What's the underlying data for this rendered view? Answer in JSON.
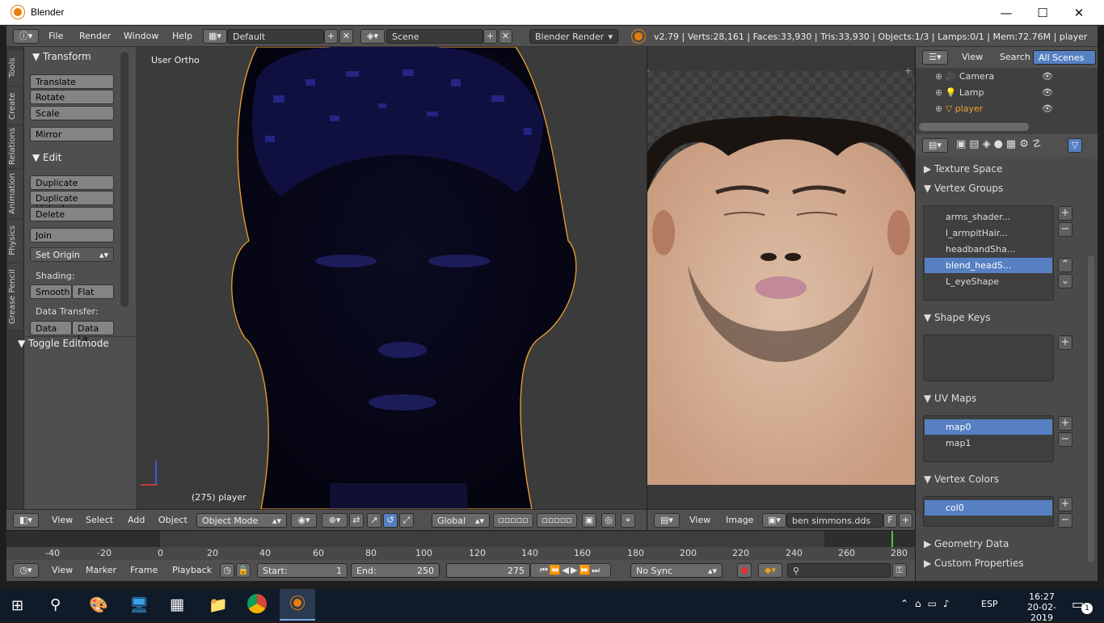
{
  "window": {
    "app_title": "Blender",
    "minimize": "—",
    "maximize": "☐",
    "close": "✕"
  },
  "infobar": {
    "menus": [
      "File",
      "Render",
      "Window",
      "Help"
    ],
    "screen_layout": "Default",
    "scene": "Scene",
    "render_engine": "Blender Render",
    "stats": "v2.79 | Verts:28,161 | Faces:33,930 | Tris:33,930 | Objects:1/3 | Lamps:0/1 | Mem:72.76M | player"
  },
  "vtabs": [
    "Tools",
    "Create",
    "Relations",
    "Animation",
    "Physics",
    "Grease Pencil"
  ],
  "toolshelf": {
    "transform_header": "Transform",
    "translate": "Translate",
    "rotate": "Rotate",
    "scale": "Scale",
    "mirror": "Mirror",
    "edit_header": "Edit",
    "duplicate": "Duplicate",
    "duplicate_linked": "Duplicate Linked",
    "delete": "Delete",
    "join": "Join",
    "set_origin": "Set Origin",
    "shading_label": "Shading:",
    "smooth": "Smooth",
    "flat": "Flat",
    "data_transfer_label": "Data Transfer:",
    "data": "Data",
    "data_la": "Data La",
    "toggle_editmode": "Toggle Editmode"
  },
  "view3d": {
    "view_name": "User Ortho",
    "object_label": "(275) player",
    "header": {
      "view": "View",
      "select": "Select",
      "add": "Add",
      "object": "Object",
      "mode": "Object Mode",
      "orientation": "Global"
    }
  },
  "uv": {
    "header": {
      "view": "View",
      "image": "Image",
      "image_name": "ben simmons.dds",
      "fake": "F"
    }
  },
  "timeline": {
    "ticks": [
      "-40",
      "-20",
      "0",
      "20",
      "40",
      "60",
      "80",
      "100",
      "120",
      "140",
      "160",
      "180",
      "200",
      "220",
      "240",
      "260",
      "280"
    ],
    "header": {
      "view": "View",
      "marker": "Marker",
      "frame": "Frame",
      "playback": "Playback",
      "start_label": "Start:",
      "start": "1",
      "end_label": "End:",
      "end": "250",
      "current": "275",
      "sync": "No Sync"
    }
  },
  "outliner": {
    "view": "View",
    "search": "Search",
    "filter": "All Scenes",
    "items": [
      "Camera",
      "Lamp",
      "player"
    ]
  },
  "properties": {
    "texture_space": "Texture Space",
    "vertex_groups_header": "Vertex Groups",
    "vertex_groups": [
      "arms_shader...",
      "l_armpitHair...",
      "headbandSha...",
      "blend_headS...",
      "L_eyeShape"
    ],
    "shape_keys_header": "Shape Keys",
    "uv_maps_header": "UV Maps",
    "uv_maps": [
      "map0",
      "map1"
    ],
    "vertex_colors_header": "Vertex Colors",
    "vertex_colors": [
      "col0"
    ],
    "geometry_data": "Geometry Data",
    "custom_properties": "Custom Properties"
  },
  "taskbar": {
    "time": "16:27",
    "date": "20-02-2019",
    "lang": "ESP",
    "notifications": "1"
  },
  "colors": {
    "accent": "#5680c2",
    "blender_orange": "#e87d0d",
    "selected_outline": "#f0a030"
  }
}
